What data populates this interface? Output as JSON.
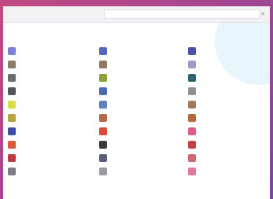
{
  "search": {
    "scope_label": "",
    "placeholder": "",
    "clear_icon": "close-icon"
  },
  "heading": "",
  "apps": {
    "col1": [
      {
        "label": "",
        "icon": "app-icon",
        "color": "#7b7fd6"
      },
      {
        "label": "",
        "icon": "feather-app-icon",
        "color": "#8b7d65"
      },
      {
        "label": "",
        "icon": "app-icon",
        "color": "#6d6d72"
      },
      {
        "label": "",
        "icon": "app-icon",
        "color": "#55565c"
      },
      {
        "label": "",
        "icon": "app-icon",
        "color": "#d8dd4a"
      },
      {
        "label": "",
        "icon": "app-icon",
        "color": "#b9a240"
      },
      {
        "label": "",
        "icon": "app-icon",
        "color": "#3d4da3"
      },
      {
        "label": "",
        "icon": "app-icon",
        "color": "#d95a3f"
      },
      {
        "label": "",
        "icon": "app-icon",
        "color": "#c2373d"
      },
      {
        "label": "",
        "icon": "app-icon",
        "color": "#7c7c86"
      }
    ],
    "col2": [
      {
        "label": "",
        "icon": "app-icon",
        "color": "#5566b8"
      },
      {
        "label": "",
        "icon": "app-icon",
        "color": "#8f7a60"
      },
      {
        "label": "",
        "icon": "app-icon",
        "color": "#8ba33a"
      },
      {
        "label": "",
        "icon": "app-icon",
        "color": "#4c6bb0"
      },
      {
        "label": "",
        "icon": "app-icon",
        "color": "#5f7fbf"
      },
      {
        "label": "",
        "icon": "app-icon",
        "color": "#b36a4a"
      },
      {
        "label": "",
        "icon": "app-icon",
        "color": "#d94a3a"
      },
      {
        "label": "",
        "icon": "app-icon",
        "color": "#3a3a3e"
      },
      {
        "label": "",
        "icon": "app-icon",
        "color": "#5b5f7a"
      },
      {
        "label": "",
        "icon": "app-icon",
        "color": "#9a9aa0"
      }
    ],
    "col3": [
      {
        "label": "",
        "icon": "app-icon",
        "color": "#4e4fa8"
      },
      {
        "label": "",
        "icon": "app-icon",
        "color": "#9c9cc8"
      },
      {
        "label": "",
        "icon": "app-icon",
        "color": "#2f6470"
      },
      {
        "label": "",
        "icon": "app-icon",
        "color": "#8e8e94"
      },
      {
        "label": "",
        "icon": "app-icon",
        "color": "#a47a5c"
      },
      {
        "label": "",
        "icon": "app-icon",
        "color": "#b8693f"
      },
      {
        "label": "",
        "icon": "app-icon",
        "color": "#e05a8a"
      },
      {
        "label": "",
        "icon": "app-icon",
        "color": "#c04048"
      },
      {
        "label": "",
        "icon": "app-icon",
        "color": "#d06a72"
      },
      {
        "label": "",
        "icon": "app-icon",
        "color": "#e07aa0"
      }
    ]
  }
}
